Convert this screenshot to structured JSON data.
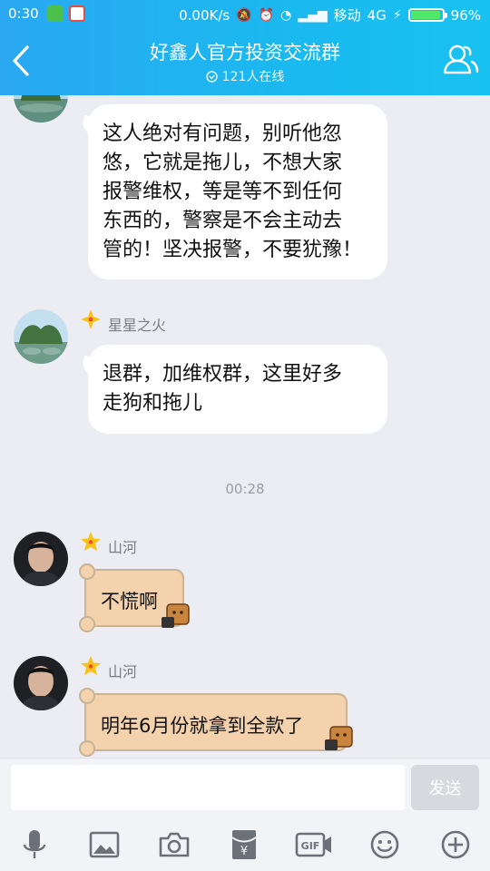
{
  "status_bar": {
    "time": "0:30",
    "net_speed": "0.00K/s",
    "carrier": "移动",
    "network": "4G",
    "battery": "96%",
    "battery_level": 0.96
  },
  "header": {
    "title": "好鑫人官方投资交流群",
    "online": "121人在线"
  },
  "messages": [
    {
      "sender": "",
      "text_lines": [
        "这人绝对有问题，别听他忽",
        "悠，它就是拖儿，不想大家",
        "报警维权，等是等不到任何",
        "东西的，警察是不会主动去",
        "管的！坚决报警，不要犹豫！"
      ]
    },
    {
      "sender": "星星之火",
      "text_lines": [
        "退群，加维权群，这里好多",
        "走狗和拖儿"
      ]
    },
    {
      "time": "00:28"
    },
    {
      "sender": "山河",
      "text": "不慌啊"
    },
    {
      "sender": "山河",
      "text": "明年6月份就拿到全款了"
    }
  ],
  "input": {
    "placeholder": "",
    "send_label": "发送"
  },
  "toolbar": [
    "microphone-icon",
    "image-icon",
    "camera-icon",
    "red-packet-icon",
    "gif-icon",
    "emoji-icon",
    "plus-icon"
  ],
  "colors": {
    "header": "#2aa8f2",
    "bubble": "#ffffff",
    "scroll_bubble": "#f3d2ad",
    "badge_gold": "#f8c21a"
  }
}
